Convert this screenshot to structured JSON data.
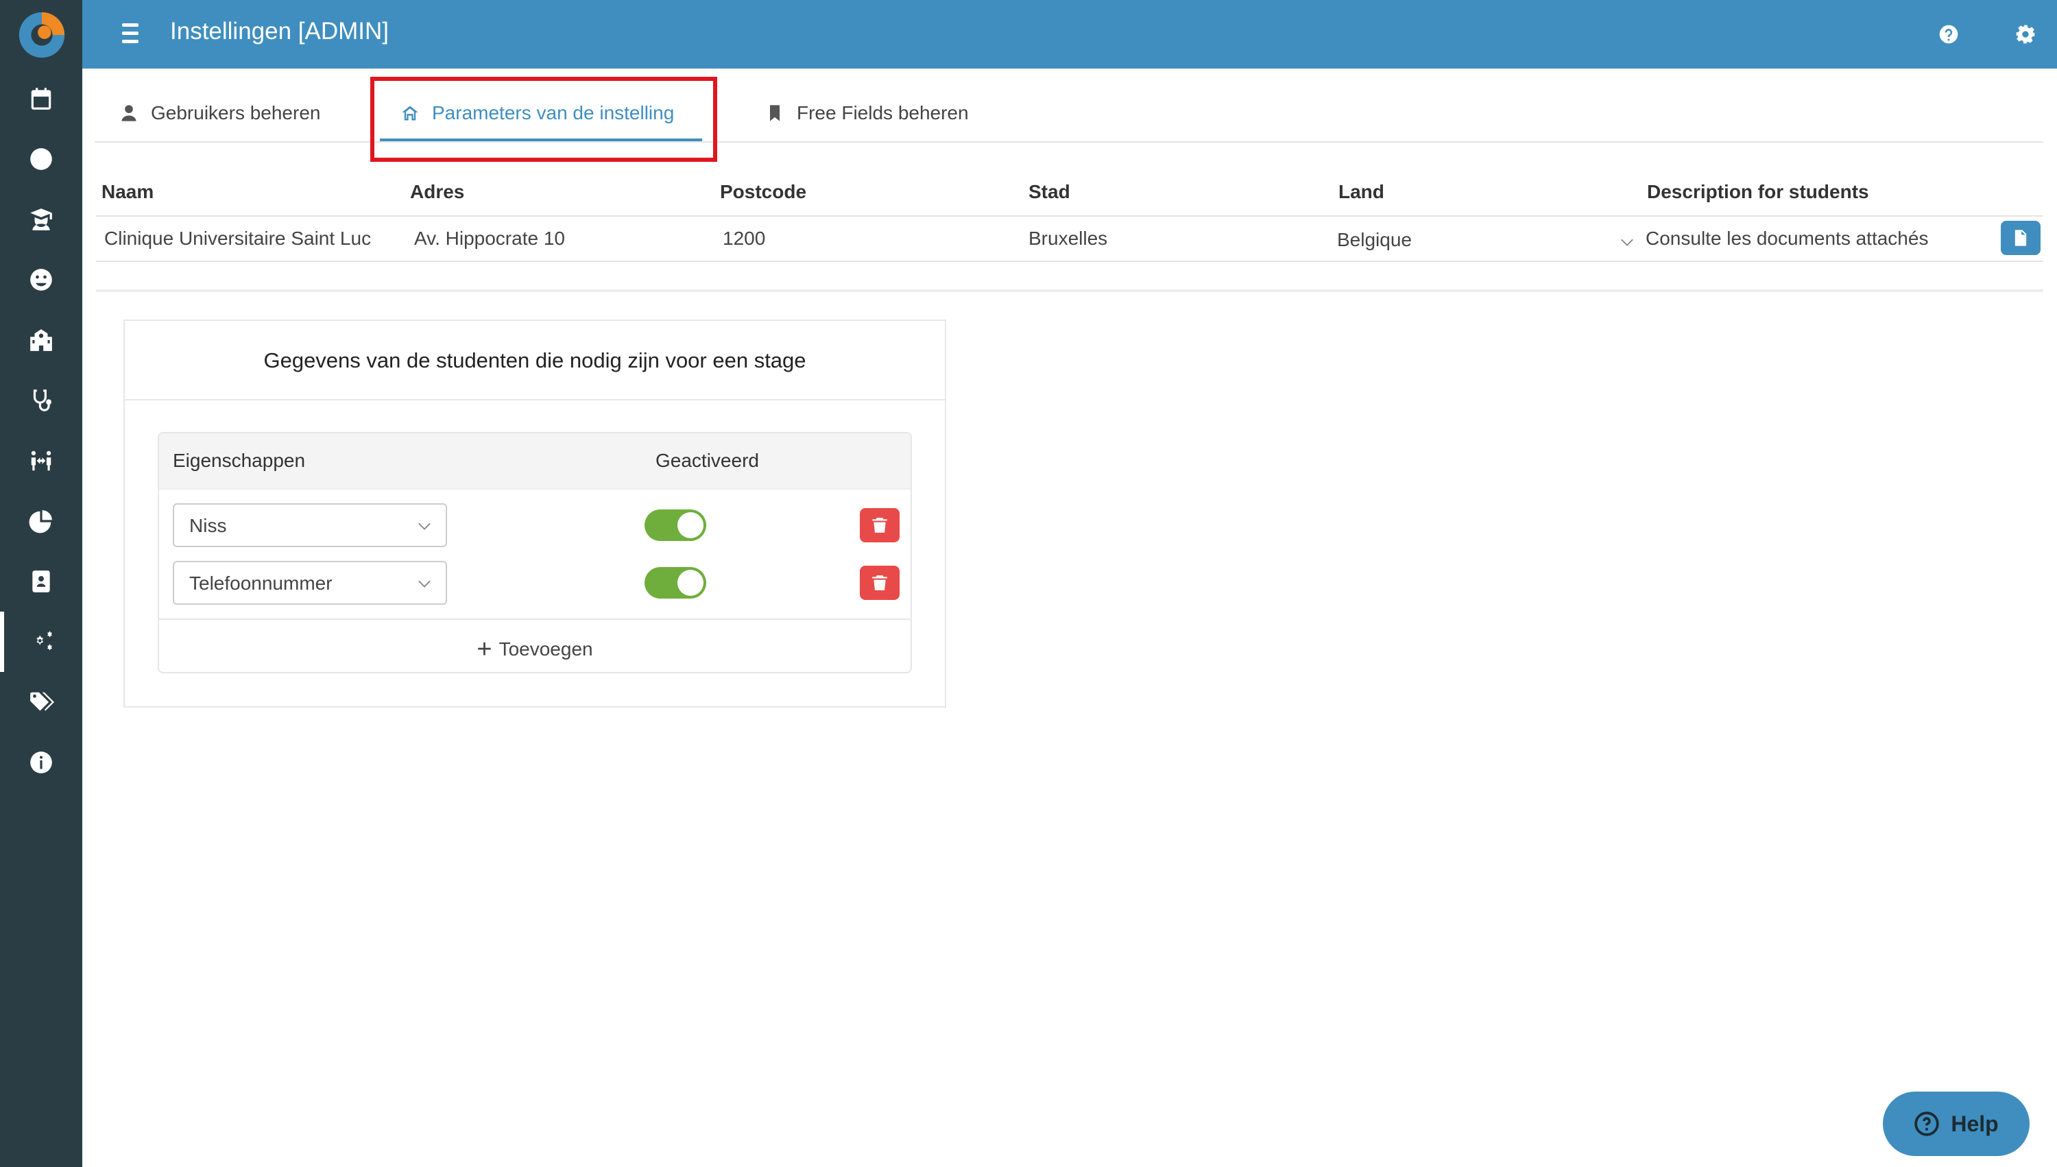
{
  "header": {
    "title": "Instellingen [ADMIN]"
  },
  "tabs": [
    {
      "label": "Gebruikers beheren",
      "icon": "user-icon"
    },
    {
      "label": "Parameters van de instelling",
      "icon": "home-icon",
      "active": true
    },
    {
      "label": "Free Fields beheren",
      "icon": "bookmark-icon"
    }
  ],
  "table": {
    "headers": [
      "Naam",
      "Adres",
      "Postcode",
      "Stad",
      "Land",
      "Description for students"
    ],
    "row": {
      "naam": "Clinique Universitaire Saint Luc",
      "adres": "Av. Hippocrate 10",
      "postcode": "1200",
      "stad": "Bruxelles",
      "land": "Belgique",
      "description": "Consulte les documents attachés"
    }
  },
  "panel": {
    "title": "Gegevens van de studenten die nodig zijn voor een stage",
    "col_properties": "Eigenschappen",
    "col_activated": "Geactiveerd",
    "rows": [
      {
        "property": "Niss",
        "activated": true
      },
      {
        "property": "Telefoonnummer",
        "activated": true
      }
    ],
    "add_label": "Toevoegen"
  },
  "help": {
    "label": "Help"
  },
  "colors": {
    "primary": "#3f8ebf",
    "sidebar": "#2b3d44",
    "toggle_on": "#6fae3c",
    "danger": "#e84a4a",
    "highlight": "#e0161f"
  }
}
